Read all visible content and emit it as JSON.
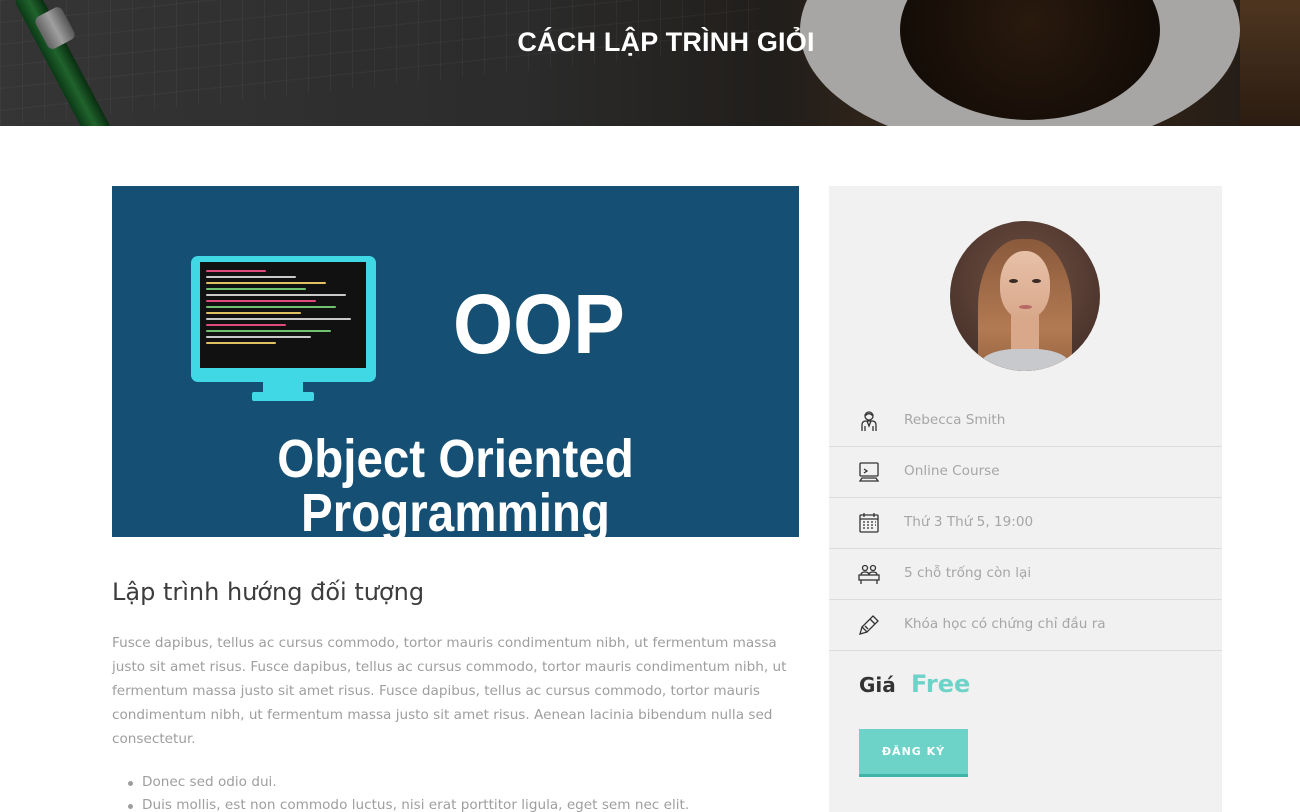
{
  "header": {
    "title": "CÁCH LẬP TRÌNH GIỎI"
  },
  "course_image": {
    "title": "OOP",
    "subtitle": "Object Oriented Programming"
  },
  "course": {
    "heading": "Lập trình hướng đối tượng",
    "description": "Fusce dapibus, tellus ac cursus commodo, tortor mauris condimentum nibh, ut fermentum massa justo sit amet risus. Fusce dapibus, tellus ac cursus commodo, tortor mauris condimentum nibh, ut fermentum massa justo sit amet risus. Fusce dapibus, tellus ac cursus commodo, tortor mauris condimentum nibh, ut fermentum massa justo sit amet risus. Aenean lacinia bibendum nulla sed consectetur.",
    "features": [
      "Donec sed odio dui.",
      "Duis mollis, est non commodo luctus, nisi erat porttitor ligula, eget  sem nec elit."
    ]
  },
  "sidebar": {
    "info": [
      {
        "icon": "teacher-icon",
        "text": "Rebecca Smith"
      },
      {
        "icon": "computer-icon",
        "text": "Online Course"
      },
      {
        "icon": "calendar-icon",
        "text": "Thứ 3 Thứ 5, 19:00"
      },
      {
        "icon": "seats-icon",
        "text": "5 chỗ trống còn lại"
      },
      {
        "icon": "certificate-pen-icon",
        "text": "Khóa học có chứng chỉ đầu ra"
      }
    ],
    "price_label": "Giá",
    "price_value": "Free",
    "register_label": "ĐĂNG KÝ"
  },
  "colors": {
    "accent": "#6dd3c8",
    "image_background": "#154f74",
    "monitor": "#41d8e6",
    "sidebar_background": "#f1f1f1"
  }
}
